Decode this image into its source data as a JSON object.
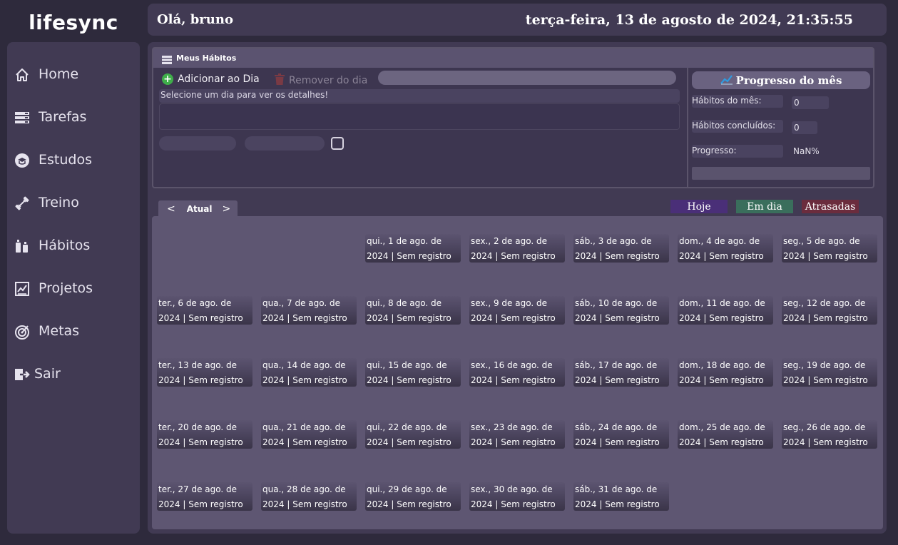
{
  "app": {
    "title": "lifesync"
  },
  "sidebar": {
    "items": [
      {
        "label": "Home",
        "icon": "home-icon"
      },
      {
        "label": "Tarefas",
        "icon": "tasks-icon"
      },
      {
        "label": "Estudos",
        "icon": "graduation-cap-icon"
      },
      {
        "label": "Treino",
        "icon": "dumbbell-icon"
      },
      {
        "label": "Hábitos",
        "icon": "bottles-icon"
      },
      {
        "label": "Projetos",
        "icon": "chart-icon"
      },
      {
        "label": "Metas",
        "icon": "target-icon"
      },
      {
        "label": "Sair",
        "icon": "logout-icon"
      }
    ]
  },
  "header": {
    "greeting": "Olá, bruno",
    "datetime": "terça-feira, 13 de agosto de 2024, 21:35:55"
  },
  "habits": {
    "title": "Meus Hábitos",
    "add_label": "Adicionar ao Dia",
    "remove_label": "Remover do dia",
    "detail_hint": "Selecione um dia para ver os detalhes!"
  },
  "progress": {
    "title": "Progresso do mês",
    "habits_month_label": "Hábitos do mês:",
    "habits_month_value": "0",
    "habits_done_label": "Hábitos concluídos:",
    "habits_done_value": "0",
    "progress_label": "Progresso:",
    "progress_value": "NaN%"
  },
  "calendar": {
    "prev": "<",
    "current": "Atual",
    "next": ">",
    "legend": {
      "today": "Hoje",
      "on_time": "Em dia",
      "late": "Atrasadas"
    },
    "days": [
      "qui., 1 de ago. de 2024 | Sem registro",
      "sex., 2 de ago. de 2024 | Sem registro",
      "sáb., 3 de ago. de 2024 | Sem registro",
      "dom., 4 de ago. de 2024 | Sem registro",
      "seg., 5 de ago. de 2024 | Sem registro",
      "ter., 6 de ago. de 2024 | Sem registro",
      "qua., 7 de ago. de 2024 | Sem registro",
      "qui., 8 de ago. de 2024 | Sem registro",
      "sex., 9 de ago. de 2024 | Sem registro",
      "sáb., 10 de ago. de 2024 | Sem registro",
      "dom., 11 de ago. de 2024 | Sem registro",
      "seg., 12 de ago. de 2024 | Sem registro",
      "ter., 13 de ago. de 2024 | Sem registro",
      "qua., 14 de ago. de 2024 | Sem registro",
      "qui., 15 de ago. de 2024 | Sem registro",
      "sex., 16 de ago. de 2024 | Sem registro",
      "sáb., 17 de ago. de 2024 | Sem registro",
      "dom., 18 de ago. de 2024 | Sem registro",
      "seg., 19 de ago. de 2024 | Sem registro",
      "ter., 20 de ago. de 2024 | Sem registro",
      "qua., 21 de ago. de 2024 | Sem registro",
      "qui., 22 de ago. de 2024 | Sem registro",
      "sex., 23 de ago. de 2024 | Sem registro",
      "sáb., 24 de ago. de 2024 | Sem registro",
      "dom., 25 de ago. de 2024 | Sem registro",
      "seg., 26 de ago. de 2024 | Sem registro",
      "ter., 27 de ago. de 2024 | Sem registro",
      "qua., 28 de ago. de 2024 | Sem registro",
      "qui., 29 de ago. de 2024 | Sem registro",
      "sex., 30 de ago. de 2024 | Sem registro",
      "sáb., 31 de ago. de 2024 | Sem registro"
    ]
  }
}
